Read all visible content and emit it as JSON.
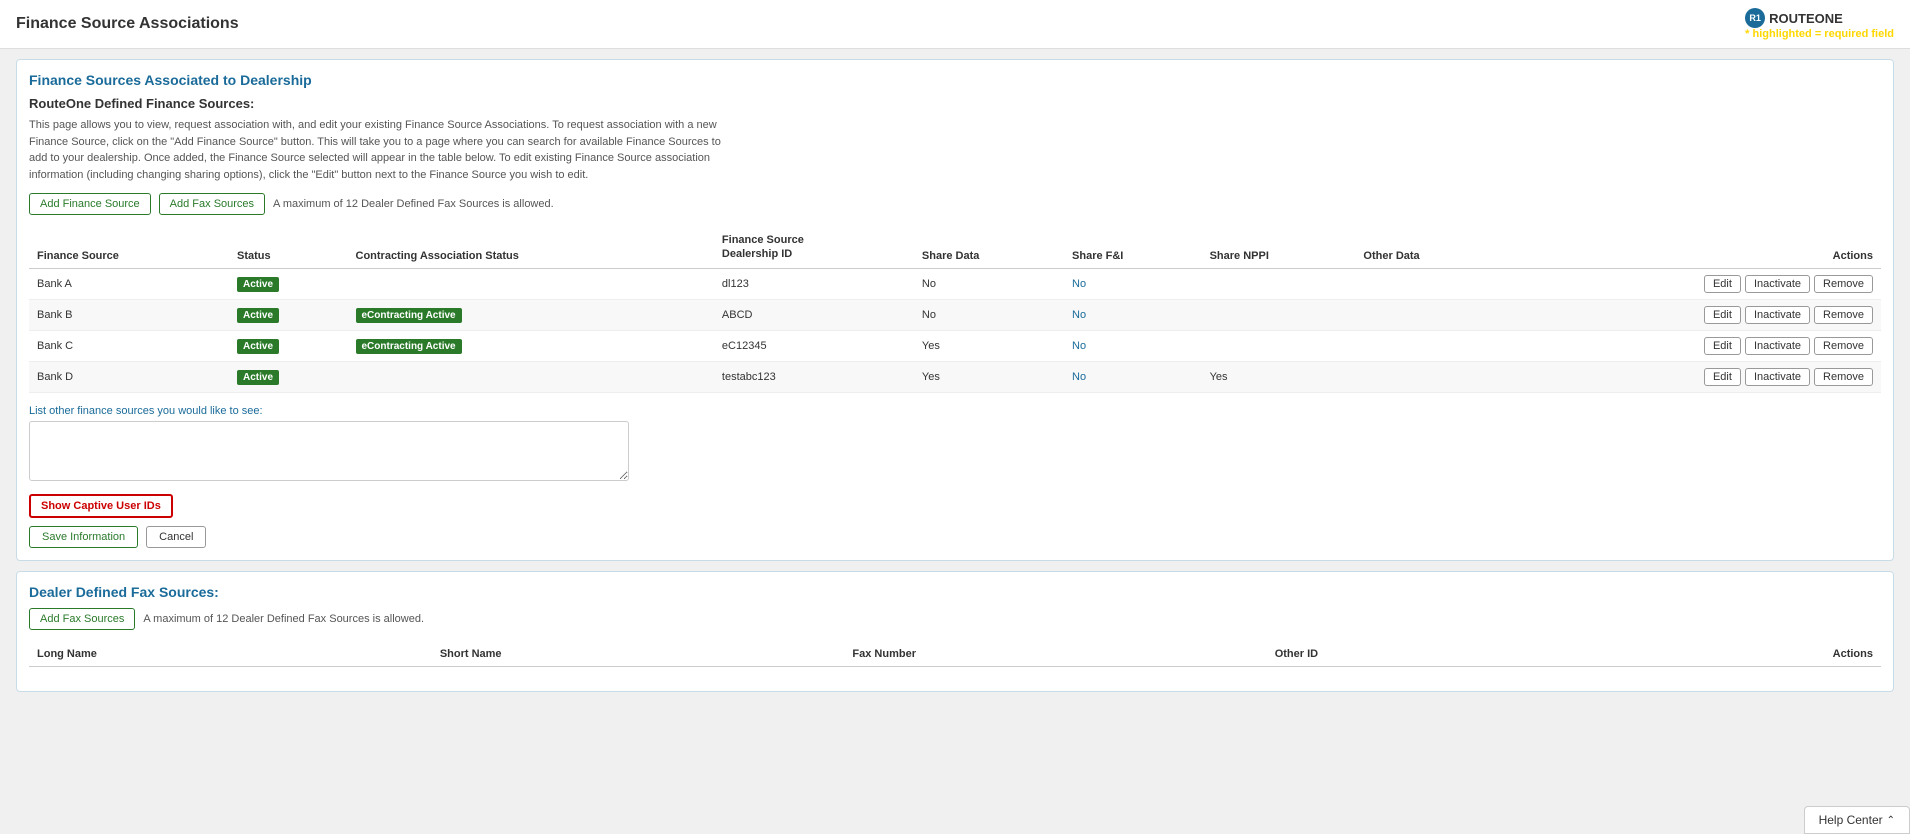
{
  "page": {
    "title": "Finance Source Associations",
    "logo_text": "ROUTEONE",
    "required_note": "* highlighted = required field"
  },
  "section1": {
    "title": "Finance Sources Associated to Dealership",
    "subsection_title": "RouteOne Defined Finance Sources:",
    "description": "This page allows you to view, request association with, and edit your existing Finance Source Associations. To request association with a new Finance Source, click on the \"Add Finance Source\" button. This will take you to a page where you can search for available Finance Sources to add to your dealership. Once added, the Finance Source selected will appear in the table below. To edit existing Finance Source association information (including changing sharing options), click the \"Edit\" button next to the Finance Source you wish to edit.",
    "add_finance_btn": "Add Finance Source",
    "add_fax_btn": "Add Fax Sources",
    "max_note": "A maximum of 12 Dealer Defined Fax Sources is allowed.",
    "table": {
      "headers": [
        "Finance Source",
        "Status",
        "Contracting Association Status",
        "Finance Source\nDealership ID",
        "Share Data",
        "Share F&I",
        "Share NPPI",
        "Other Data",
        "Actions"
      ],
      "rows": [
        {
          "name": "Bank A",
          "status": "Active",
          "contracting": "",
          "dealership_id": "dl123",
          "share_data": "No",
          "share_fni": "No",
          "share_nppi": "",
          "other_data": "",
          "has_contracting": false
        },
        {
          "name": "Bank B",
          "status": "Active",
          "contracting": "eContracting Active",
          "dealership_id": "ABCD",
          "share_data": "No",
          "share_fni": "No",
          "share_nppi": "",
          "other_data": "",
          "has_contracting": true
        },
        {
          "name": "Bank C",
          "status": "Active",
          "contracting": "eContracting Active",
          "dealership_id": "eC12345",
          "share_data": "Yes",
          "share_fni": "No",
          "share_nppi": "",
          "other_data": "",
          "has_contracting": true
        },
        {
          "name": "Bank D",
          "status": "Active",
          "contracting": "",
          "dealership_id": "testabc123",
          "share_data": "Yes",
          "share_fni": "No",
          "share_nppi": "Yes",
          "other_data": "",
          "has_contracting": false
        }
      ]
    },
    "list_other_label": "List other finance sources you would like to see:",
    "show_captive_btn": "Show Captive User IDs",
    "save_btn": "Save Information",
    "cancel_btn": "Cancel"
  },
  "section2": {
    "title": "Dealer Defined Fax Sources:",
    "add_fax_btn": "Add Fax Sources",
    "max_note": "A maximum of 12 Dealer Defined Fax Sources is allowed.",
    "table": {
      "headers": [
        "Long Name",
        "Short Name",
        "Fax Number",
        "Other ID",
        "Actions"
      ]
    }
  },
  "help_center": {
    "label": "Help Center"
  },
  "actions": {
    "edit": "Edit",
    "inactivate": "Inactivate",
    "remove": "Remove"
  }
}
